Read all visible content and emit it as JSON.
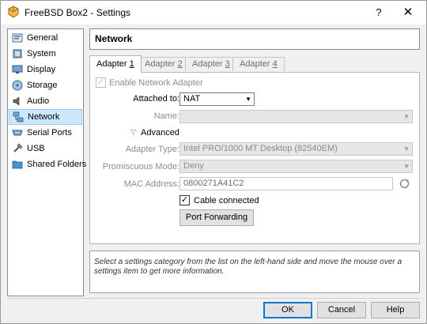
{
  "window": {
    "title": "FreeBSD Box2 - Settings",
    "help_glyph": "?",
    "close_glyph": "✕"
  },
  "sidebar": {
    "items": [
      {
        "label": "General",
        "icon": "general-icon"
      },
      {
        "label": "System",
        "icon": "system-icon"
      },
      {
        "label": "Display",
        "icon": "display-icon"
      },
      {
        "label": "Storage",
        "icon": "storage-icon"
      },
      {
        "label": "Audio",
        "icon": "audio-icon"
      },
      {
        "label": "Network",
        "icon": "network-icon",
        "selected": true
      },
      {
        "label": "Serial Ports",
        "icon": "serial-ports-icon"
      },
      {
        "label": "USB",
        "icon": "usb-icon"
      },
      {
        "label": "Shared Folders",
        "icon": "shared-folders-icon"
      }
    ]
  },
  "header": {
    "title": "Network"
  },
  "tabs": [
    {
      "label": "Adapter ",
      "key": "1",
      "active": true
    },
    {
      "label": "Adapter ",
      "key": "2"
    },
    {
      "label": "Adapter ",
      "key": "3"
    },
    {
      "label": "Adapter ",
      "key": "4"
    }
  ],
  "adapter": {
    "enable_label": "Enable Network Adapter",
    "enabled": true,
    "attached_to_label": "Attached to:",
    "attached_to_value": "NAT",
    "name_label": "Name:",
    "name_value": "",
    "advanced_label": "Advanced",
    "adapter_type_label": "Adapter Type:",
    "adapter_type_value": "Intel PRO/1000 MT Desktop (82540EM)",
    "promiscuous_label": "Promiscuous Mode:",
    "promiscuous_value": "Deny",
    "mac_label": "MAC Address:",
    "mac_value": "0800271A41C2",
    "cable_label": "Cable connected",
    "cable_connected": true,
    "port_forwarding_label": "Port Forwarding"
  },
  "info_text": "Select a settings category from the list on the left-hand side and move the mouse over a settings item to get more information.",
  "buttons": {
    "ok": "OK",
    "cancel": "Cancel",
    "help": "Help"
  },
  "colors": {
    "accent": "#0078d7",
    "selection": "#cce8ff"
  }
}
